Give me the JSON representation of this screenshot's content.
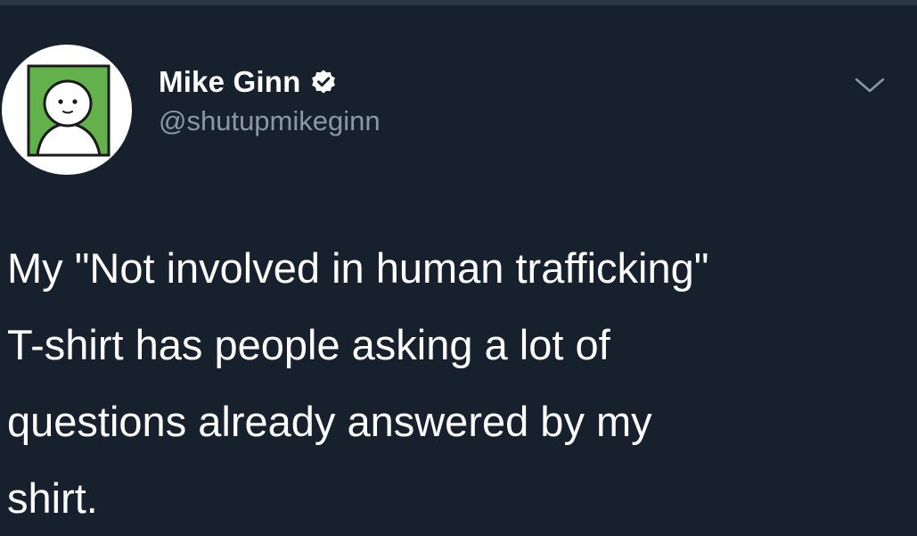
{
  "author": {
    "display_name": "Mike Ginn",
    "handle": "@shutupmikeginn",
    "verified": true,
    "avatar_icon": "cartoon-person-avatar-icon",
    "verified_icon": "verified-badge-icon"
  },
  "menu": {
    "icon": "chevron-down-icon"
  },
  "tweet": {
    "text": "My \"Not involved in human trafficking\"\nT-shirt has people asking a lot of\nquestions already answered by my\nshirt."
  },
  "colors": {
    "background": "#17212e",
    "text_primary": "#ffffff",
    "text_secondary": "#8899a6",
    "avatar_green": "#62b14a"
  }
}
